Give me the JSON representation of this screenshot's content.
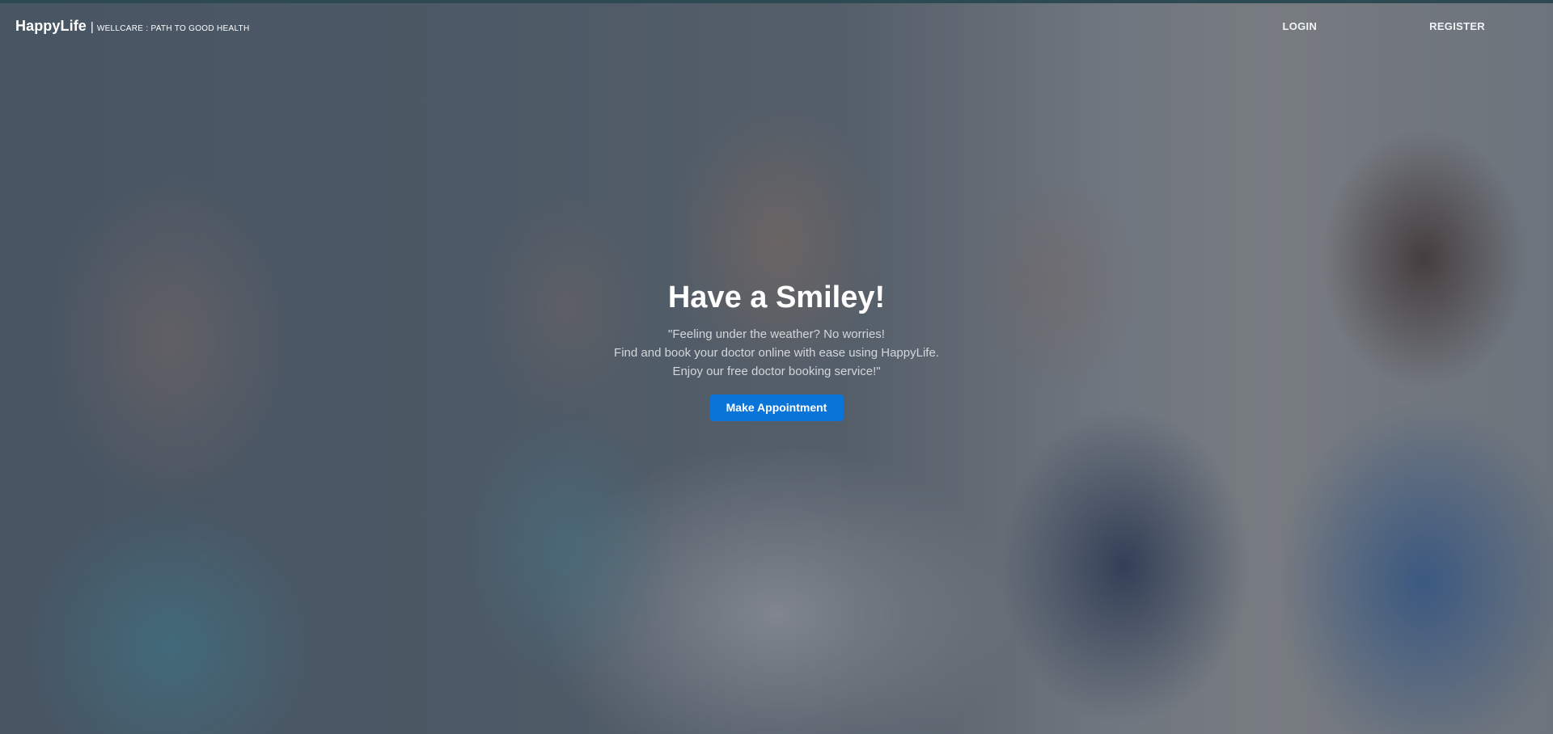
{
  "navbar": {
    "brand_name": "HappyLife",
    "brand_separator": "|",
    "brand_tagline": "WELLCARE : PATH TO GOOD HEALTH",
    "links": {
      "login": "LOGIN",
      "register": "REGISTER"
    }
  },
  "hero": {
    "title": "Have a Smiley!",
    "lines": [
      "\"Feeling under the weather? No worries!",
      "Find and book your doctor online with ease using HappyLife.",
      "Enjoy our free doctor booking service!\""
    ],
    "cta_label": "Make Appointment"
  },
  "colors": {
    "accent": "#0b74d8",
    "top_border": "#2d4a52",
    "text_primary": "#ffffff",
    "text_secondary": "#d3d7db"
  }
}
